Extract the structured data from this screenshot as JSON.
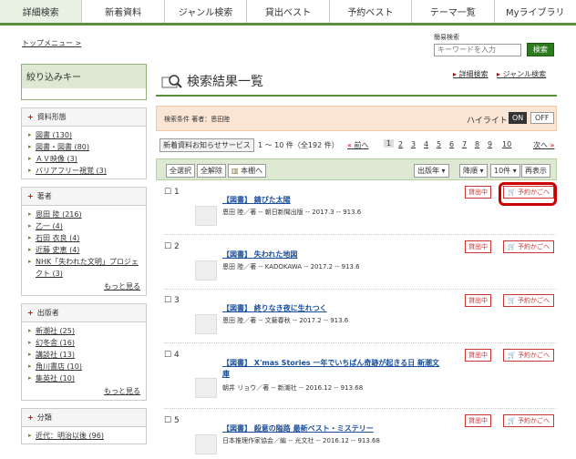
{
  "nav": {
    "tabs": [
      "詳細検索",
      "新着資料",
      "ジャンル検索",
      "貸出ベスト",
      "予約ベスト",
      "テーマ一覧",
      "Myライブラリ"
    ]
  },
  "breadcrumb": "トップメニュー >",
  "quick": {
    "label": "簡易検索",
    "placeholder": "キーワードを入力",
    "button": "検索"
  },
  "sidebar": {
    "title": "絞り込みキー",
    "sections": [
      {
        "title": "資料形態",
        "items": [
          "図書 (130)",
          "図書・図書 (80)",
          "ＡＶ映像 (3)",
          "バリアフリー視覚 (3)"
        ],
        "more": ""
      },
      {
        "title": "著者",
        "items": [
          "恩田 陸 (216)",
          "乙一 (4)",
          "石田 衣良 (4)",
          "近藤 史恵 (4)",
          "NHK「失われた文明」プロジェクト (3)"
        ],
        "more": "もっと見る"
      },
      {
        "title": "出版者",
        "items": [
          "新潮社 (25)",
          "幻冬舎 (16)",
          "講談社 (13)",
          "角川書店 (10)",
          "集英社 (10)"
        ],
        "more": "もっと見る"
      },
      {
        "title": "分類",
        "items": [
          "近代：明治以後 (96)"
        ],
        "more": ""
      }
    ]
  },
  "main": {
    "title": "検索結果一覧",
    "link_detail": "詳細検索",
    "link_genre": "ジャンル検索",
    "condition": "検索条件 著者：恩田陸",
    "highlight_label": "ハイライト：",
    "highlight_on": "ON",
    "highlight_off": "OFF",
    "notify_button": "新着資料お知らせサービス",
    "count": "1 ～ 10 件（全192 件）",
    "prev": "前へ",
    "pages": [
      "1",
      "2",
      "3",
      "4",
      "5",
      "6",
      "7",
      "8",
      "9",
      "10"
    ],
    "next": "次へ",
    "select_all": "全選択",
    "deselect_all": "全解除",
    "shelf": "本棚へ",
    "sort_field": "出版年",
    "sort_order": "降順",
    "per_page": "10件",
    "redisplay": "再表示",
    "lend_label": "貸出中",
    "reserve_label": "予約かごへ",
    "results": [
      {
        "no": "1",
        "title": "【図書】 錆びた太陽",
        "sub": "恩田 陸／著 -- 朝日新聞出版 -- 2017.3 -- 913.6"
      },
      {
        "no": "2",
        "title": "【図書】 失われた地図",
        "sub": "恩田 陸／著 -- KADOKAWA -- 2017.2 -- 913.6"
      },
      {
        "no": "3",
        "title": "【図書】 終りなき夜に生れつく",
        "sub": "恩田 陸／著 -- 文藝春秋 -- 2017.2 -- 913.6"
      },
      {
        "no": "4",
        "title": "【図書】 X'mas Stories 一年でいちばん奇跡が起きる日 新潮文庫",
        "sub": "朝井 リョウ／著 -- 新潮社 -- 2016.12 -- 913.68"
      },
      {
        "no": "5",
        "title": "【図書】 殺意の隘路 最新ベスト・ミステリー",
        "sub": "日本推理作家協会／編 -- 光文社 -- 2016.12 -- 913.68"
      }
    ]
  },
  "colors": {
    "accent": "#5a8f3c",
    "lend": "#cc3333",
    "highlight": "#cc0000"
  }
}
